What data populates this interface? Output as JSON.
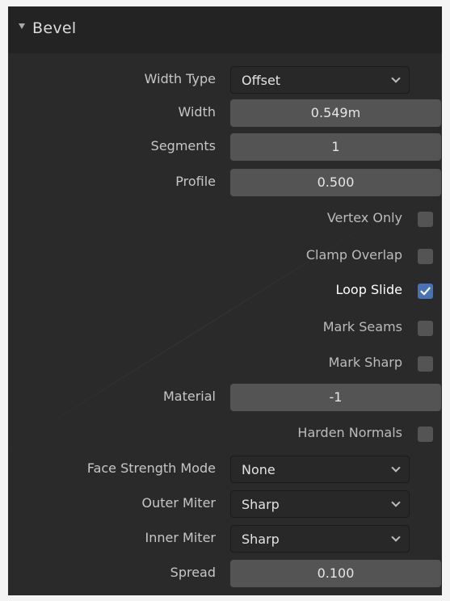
{
  "panel": {
    "title": "Bevel"
  },
  "fields": {
    "width_type": {
      "label": "Width Type",
      "value": "Offset"
    },
    "width": {
      "label": "Width",
      "value": "0.549m"
    },
    "segments": {
      "label": "Segments",
      "value": "1"
    },
    "profile": {
      "label": "Profile",
      "value": "0.500"
    },
    "material": {
      "label": "Material",
      "value": "-1"
    },
    "face_strength_mode": {
      "label": "Face Strength Mode",
      "value": "None"
    },
    "outer_miter": {
      "label": "Outer Miter",
      "value": "Sharp"
    },
    "inner_miter": {
      "label": "Inner Miter",
      "value": "Sharp"
    },
    "spread": {
      "label": "Spread",
      "value": "0.100"
    }
  },
  "checkboxes": {
    "vertex_only": {
      "label": "Vertex Only",
      "checked": false
    },
    "clamp_overlap": {
      "label": "Clamp Overlap",
      "checked": false
    },
    "loop_slide": {
      "label": "Loop Slide",
      "checked": true
    },
    "mark_seams": {
      "label": "Mark Seams",
      "checked": false
    },
    "mark_sharp": {
      "label": "Mark Sharp",
      "checked": false
    },
    "harden_normals": {
      "label": "Harden Normals",
      "checked": false
    }
  },
  "colors": {
    "panel_bg": "#2a2a2a",
    "field_bg": "#545454",
    "dropdown_bg": "#282828",
    "checkbox_checked": "#4772b3"
  },
  "icons": {
    "collapse": "triangle-down-icon",
    "dropdown": "chevron-down-icon",
    "check": "checkmark-icon"
  }
}
